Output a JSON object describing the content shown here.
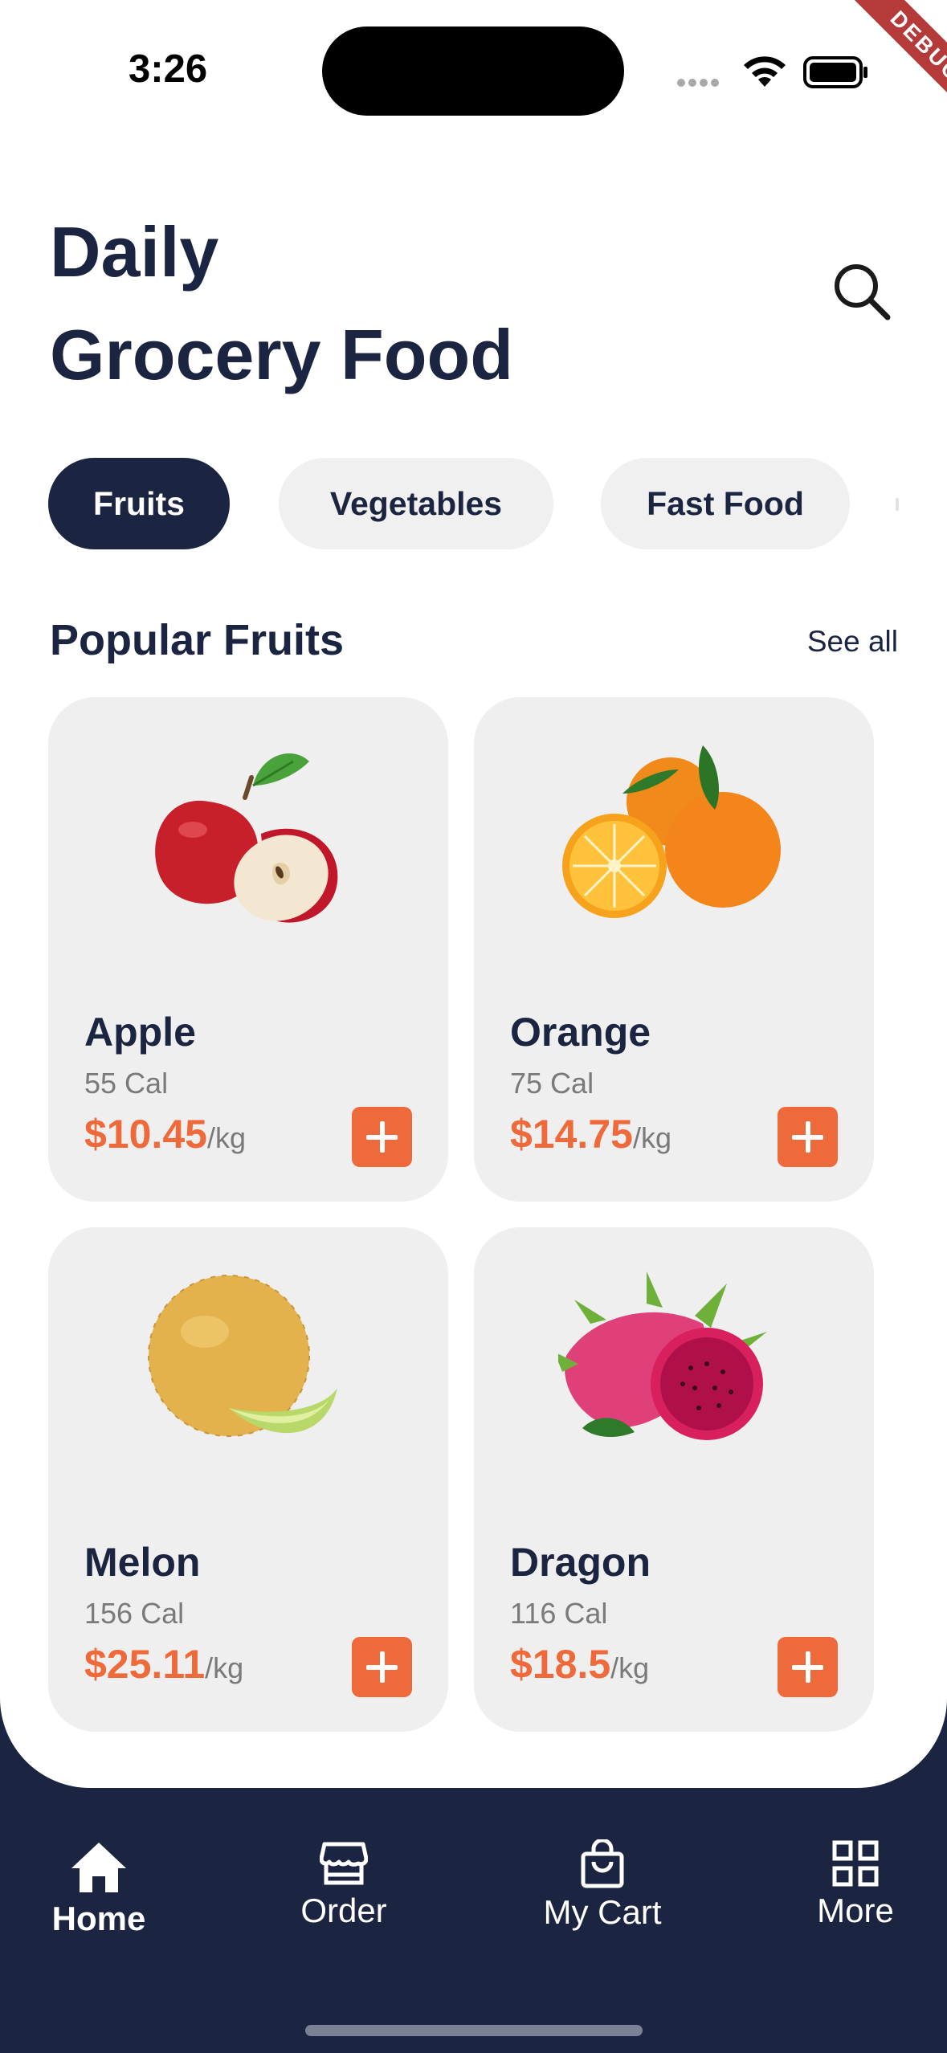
{
  "status_bar": {
    "time": "3:26",
    "debug_label": "DEBUG"
  },
  "header": {
    "title_line1": "Daily",
    "title_line2": "Grocery Food",
    "search_icon": "search-icon"
  },
  "categories": [
    {
      "label": "Fruits",
      "active": true
    },
    {
      "label": "Vegetables",
      "active": false
    },
    {
      "label": "Fast Food",
      "active": false
    }
  ],
  "section": {
    "title": "Popular Fruits",
    "see_all": "See all"
  },
  "products": [
    {
      "name": "Apple",
      "cal": "55 Cal",
      "price": "$10.45",
      "unit": "/kg"
    },
    {
      "name": "Orange",
      "cal": "75 Cal",
      "price": "$14.75",
      "unit": "/kg"
    },
    {
      "name": "Melon",
      "cal": "156 Cal",
      "price": "$25.11",
      "unit": "/kg"
    },
    {
      "name": "Dragon",
      "cal": "116 Cal",
      "price": "$18.5",
      "unit": "/kg"
    }
  ],
  "bottom_nav": [
    {
      "label": "Home",
      "icon": "home-icon",
      "active": true
    },
    {
      "label": "Order",
      "icon": "store-icon",
      "active": false
    },
    {
      "label": "My Cart",
      "icon": "shopping-bag-icon",
      "active": false
    },
    {
      "label": "More",
      "icon": "grid-icon",
      "active": false
    }
  ],
  "colors": {
    "navy": "#1b2440",
    "accent": "#ef6a3a",
    "card": "#efefef",
    "chip": "#f0f0f0"
  }
}
